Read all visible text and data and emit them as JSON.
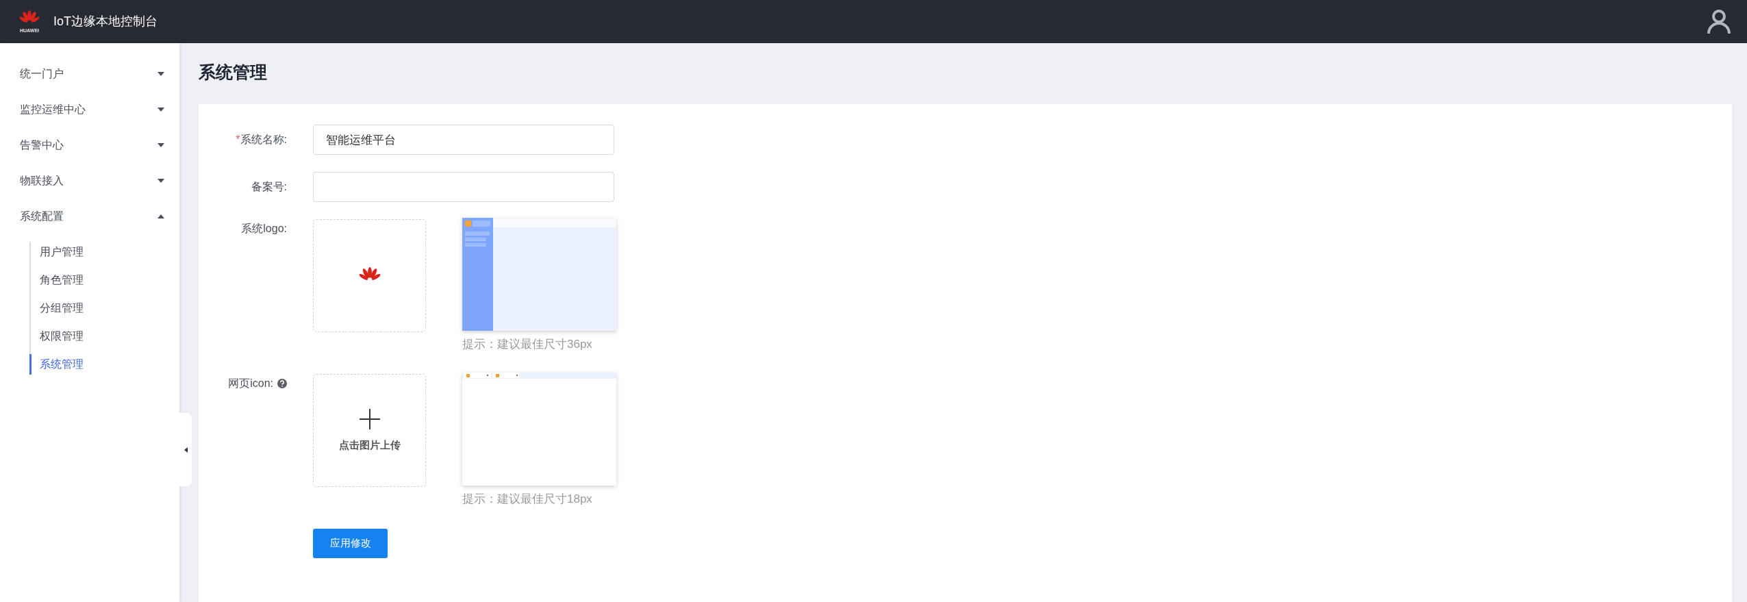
{
  "header": {
    "logo_text": "HUAWEI",
    "title": "IoT边缘本地控制台"
  },
  "sidebar": {
    "items": [
      {
        "label": "统一门户",
        "expanded": false
      },
      {
        "label": "监控运维中心",
        "expanded": false
      },
      {
        "label": "告警中心",
        "expanded": false
      },
      {
        "label": "物联接入",
        "expanded": false
      },
      {
        "label": "系统配置",
        "expanded": true,
        "children": [
          {
            "label": "用户管理",
            "selected": false
          },
          {
            "label": "角色管理",
            "selected": false
          },
          {
            "label": "分组管理",
            "selected": false
          },
          {
            "label": "权限管理",
            "selected": false
          },
          {
            "label": "系统管理",
            "selected": true
          }
        ]
      }
    ]
  },
  "page_title": "系统管理",
  "form": {
    "fields": [
      {
        "kind": "text",
        "label": "系统名称:",
        "required_mark": "*",
        "value": "智能运维平台"
      },
      {
        "kind": "text",
        "label": "备案号:"
      },
      {
        "kind": "logo",
        "label": "系统logo:",
        "hint": "提示：建议最佳尺寸36px"
      },
      {
        "kind": "icon",
        "label": "网页icon:",
        "upload_text": "点击图片上传",
        "hint": "提示：建议最佳尺寸18px"
      }
    ],
    "submit": "应用修改"
  }
}
